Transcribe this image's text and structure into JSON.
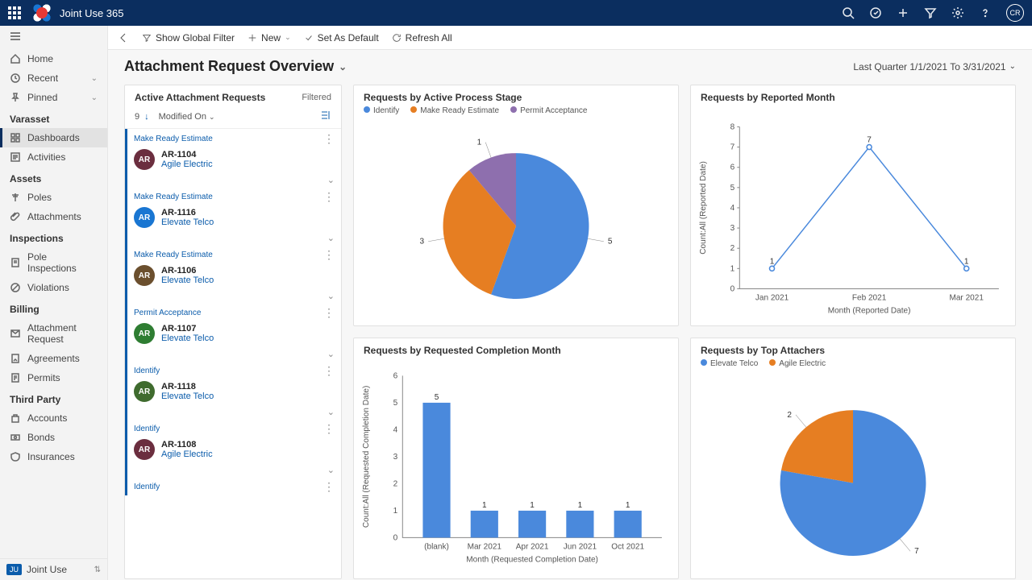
{
  "header": {
    "app_title": "Joint Use 365",
    "avatar_initials": "CR"
  },
  "commandbar": {
    "show_filter": "Show Global Filter",
    "new": "New",
    "set_default": "Set As Default",
    "refresh": "Refresh All"
  },
  "page": {
    "title": "Attachment Request Overview",
    "date_range": "Last Quarter 1/1/2021 To 3/31/2021"
  },
  "sidebar": {
    "home": "Home",
    "recent": "Recent",
    "pinned": "Pinned",
    "group_varasset": "Varasset",
    "dashboards": "Dashboards",
    "activities": "Activities",
    "group_assets": "Assets",
    "poles": "Poles",
    "attachments": "Attachments",
    "group_inspections": "Inspections",
    "pole_inspections": "Pole Inspections",
    "violations": "Violations",
    "group_billing": "Billing",
    "attachment_request": "Attachment Request",
    "agreements": "Agreements",
    "permits": "Permits",
    "group_third_party": "Third Party",
    "accounts": "Accounts",
    "bonds": "Bonds",
    "insurances": "Insurances",
    "footer_badge": "JU",
    "footer_label": "Joint Use"
  },
  "list": {
    "title": "Active Attachment Requests",
    "filtered": "Filtered",
    "count": "9",
    "sort_field": "Modified On",
    "groups": [
      {
        "stage": "Make Ready Estimate",
        "id": "AR-1104",
        "company": "Agile Electric",
        "avatar": "AR",
        "color": "#6b2e3f"
      },
      {
        "stage": "Make Ready Estimate",
        "id": "AR-1116",
        "company": "Elevate Telco",
        "avatar": "AR",
        "color": "#1976d2"
      },
      {
        "stage": "Make Ready Estimate",
        "id": "AR-1106",
        "company": "Elevate Telco",
        "avatar": "AR",
        "color": "#6b4f2e"
      },
      {
        "stage": "Permit Acceptance",
        "id": "AR-1107",
        "company": "Elevate Telco",
        "avatar": "AR",
        "color": "#2e7d32"
      },
      {
        "stage": "Identify",
        "id": "AR-1118",
        "company": "Elevate Telco",
        "avatar": "AR",
        "color": "#3f6b2e"
      },
      {
        "stage": "Identify",
        "id": "AR-1108",
        "company": "Agile Electric",
        "avatar": "AR",
        "color": "#6b2e3f"
      },
      {
        "stage": "Identify",
        "id": "",
        "company": "",
        "avatar": "",
        "color": ""
      }
    ]
  },
  "cards": {
    "pie_stage_title": "Requests by Active Process Stage",
    "line_month_title": "Requests by Reported Month",
    "bar_completion_title": "Requests by Requested Completion Month",
    "pie_attachers_title": "Requests by Top Attachers"
  },
  "chart_data": [
    {
      "type": "pie",
      "title": "Requests by Active Process Stage",
      "series": [
        {
          "name": "Identify",
          "value": 5,
          "color": "#4a89dc"
        },
        {
          "name": "Make Ready Estimate",
          "value": 3,
          "color": "#e67e22"
        },
        {
          "name": "Permit Acceptance",
          "value": 1,
          "color": "#8e6fae"
        }
      ],
      "legend": [
        "Identify",
        "Make Ready Estimate",
        "Permit Acceptance"
      ]
    },
    {
      "type": "line",
      "title": "Requests by Reported Month",
      "xlabel": "Month (Reported Date)",
      "ylabel": "Count:All (Reported Date)",
      "categories": [
        "Jan 2021",
        "Feb 2021",
        "Mar 2021"
      ],
      "values": [
        1,
        7,
        1
      ],
      "ylim": [
        0,
        8
      ]
    },
    {
      "type": "bar",
      "title": "Requests by Requested Completion Month",
      "xlabel": "Month (Requested Completion Date)",
      "ylabel": "Count:All (Requested Completion Date)",
      "categories": [
        "(blank)",
        "Mar 2021",
        "Apr 2021",
        "Jun 2021",
        "Oct 2021"
      ],
      "values": [
        5,
        1,
        1,
        1,
        1
      ],
      "ylim": [
        0,
        6
      ]
    },
    {
      "type": "pie",
      "title": "Requests by Top Attachers",
      "series": [
        {
          "name": "Elevate Telco",
          "value": 7,
          "color": "#4a89dc"
        },
        {
          "name": "Agile Electric",
          "value": 2,
          "color": "#e67e22"
        }
      ],
      "legend": [
        "Elevate Telco",
        "Agile Electric"
      ]
    }
  ]
}
